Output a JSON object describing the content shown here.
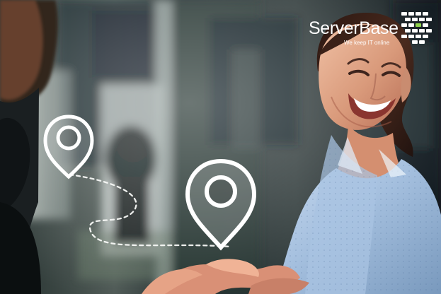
{
  "brand": {
    "name": "ServerBase",
    "tagline": "We keep IT online",
    "accent_color": "#8fd44b",
    "logo_icon": "brick-wall-logo-icon"
  },
  "scene": {
    "map_pin_icon": "map-pin-icon",
    "path_style": "dashed-route"
  }
}
